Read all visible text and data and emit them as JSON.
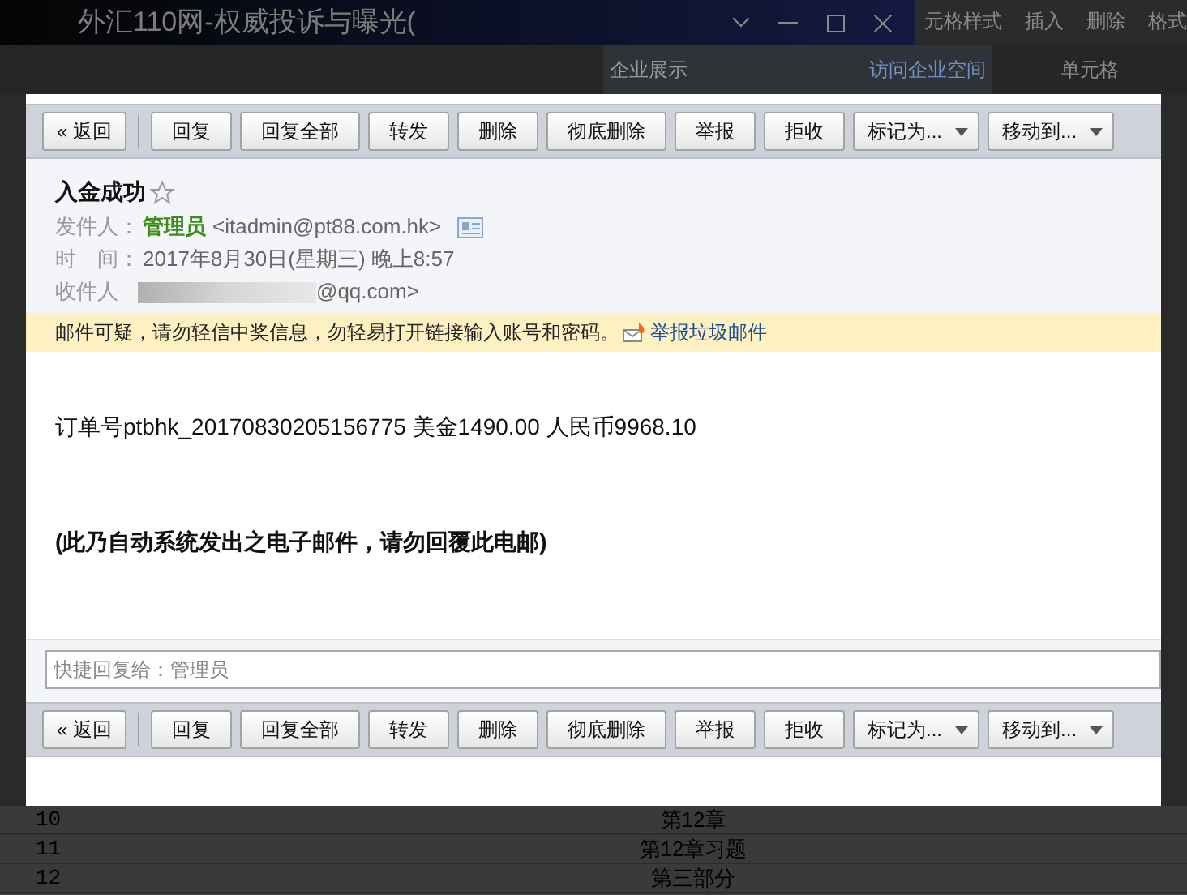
{
  "window": {
    "title": "外汇110网-权威投诉与曝光(",
    "ribbon": [
      "元格样式",
      "插入",
      "删除",
      "格式"
    ]
  },
  "background_bar": {
    "items": [
      "企业展示",
      "访问企业空间"
    ],
    "group_label": "单元格"
  },
  "toolbar_top": [
    {
      "kind": "back",
      "label": "« 返回"
    },
    {
      "kind": "button",
      "label": "回复"
    },
    {
      "kind": "button",
      "label": "回复全部"
    },
    {
      "kind": "button",
      "label": "转发"
    },
    {
      "kind": "button",
      "label": "删除"
    },
    {
      "kind": "button",
      "label": "彻底删除"
    },
    {
      "kind": "button",
      "label": "举报"
    },
    {
      "kind": "button",
      "label": "拒收"
    },
    {
      "kind": "dropdown",
      "label": "标记为..."
    },
    {
      "kind": "dropdown",
      "label": "移动到..."
    }
  ],
  "email": {
    "subject": "入金成功",
    "starred": false,
    "fields": [
      {
        "kind": "sender",
        "label": "发件人：",
        "name": "管理员",
        "value": "<itadmin@pt88.com.hk>"
      },
      {
        "kind": "plain",
        "label": "时　间：",
        "value": "2017年8月30日(星期三) 晚上8:57"
      },
      {
        "kind": "blurred",
        "label": "收件人",
        "value": "@qq.com>"
      }
    ],
    "warning": {
      "text": "邮件可疑，请勿轻信中奖信息，勿轻易打开链接输入账号和密码。",
      "link": "举报垃圾邮件"
    },
    "body": [
      {
        "kind": "normal",
        "text": "订单号ptbhk_20170830205156775 美金1490.00 人民币9968.10"
      },
      {
        "kind": "bold",
        "text": "(此乃自动系统发出之电子邮件，请勿回覆此电邮)"
      }
    ],
    "quick_reply": {
      "placeholder": "快捷回复给：管理员"
    }
  },
  "toolbar_bottom": [
    {
      "kind": "back",
      "label": "« 返回"
    },
    {
      "kind": "button",
      "label": "回复"
    },
    {
      "kind": "button",
      "label": "回复全部"
    },
    {
      "kind": "button",
      "label": "转发"
    },
    {
      "kind": "button",
      "label": "删除"
    },
    {
      "kind": "button",
      "label": "彻底删除"
    },
    {
      "kind": "button",
      "label": "举报"
    },
    {
      "kind": "button",
      "label": "拒收"
    },
    {
      "kind": "dropdown",
      "label": "标记为..."
    },
    {
      "kind": "dropdown",
      "label": "移动到..."
    }
  ],
  "sheet_rows": [
    {
      "number": "10",
      "title": "第12章"
    },
    {
      "number": "11",
      "title": "第12章习题"
    },
    {
      "number": "12",
      "title": "第三部分"
    }
  ]
}
